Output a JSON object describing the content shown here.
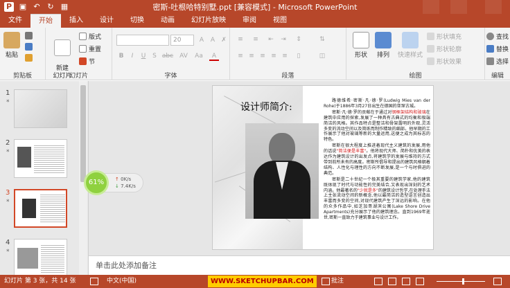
{
  "titlebar": {
    "title": "密斯-吐根哈特别墅.ppt [兼容模式] - Microsoft PowerPoint",
    "icons": [
      "app-icon",
      "save-icon",
      "undo-icon",
      "redo-icon",
      "start-icon"
    ]
  },
  "tabs": [
    "文件",
    "开始",
    "插入",
    "设计",
    "切换",
    "动画",
    "幻灯片放映",
    "审阅",
    "视图"
  ],
  "ribbon": {
    "clipboard": {
      "paste": "粘贴",
      "label": "剪贴板"
    },
    "slides": {
      "new_slide": "新建\n幻灯片",
      "layout": "版式",
      "reset": "重置",
      "section": "节",
      "label": "幻灯片"
    },
    "font": {
      "size": "20",
      "label": "字体",
      "buttons": [
        "B",
        "I",
        "U",
        "S",
        "abc",
        "AV",
        "Aa",
        "A"
      ]
    },
    "paragraph": {
      "label": "段落"
    },
    "drawing": {
      "shape": "形状",
      "arrange": "排列",
      "quick_styles": "快速样式",
      "fill": "形状填充",
      "outline": "形状轮廓",
      "effects": "形状效果",
      "label": "绘图"
    },
    "editing": {
      "find": "查找",
      "replace": "替换",
      "select": "选择",
      "label": "编辑"
    }
  },
  "thumbnails": [
    {
      "num": "1",
      "star": "*"
    },
    {
      "num": "2",
      "star": "*"
    },
    {
      "num": "3",
      "star": "*"
    },
    {
      "num": "4",
      "star": "*"
    }
  ],
  "slide": {
    "title": "设计师简介:",
    "para1_a": "路德维希·密斯·凡·德·罗(Ludwig Mies van der Rohe)于1886年3月27日出生在德国的亚琛古城。",
    "para2_a": "密斯·凡·德·罗的贡献在于通过对",
    "para2_red": "钢框架结构和玻璃",
    "para2_b": "在建筑中应用的探索,发展了一种具有古典式的均衡和极端简洁的风格。其作品特点是整洁和骨架露明的外观,灵活多变的流动空间以及简练而制作精致的细部。他早期的工作展示了他对玻璃等新的大量运用,这便之成为其标志的特色。",
    "para3_a": "密斯在很大程度上推进着现代主义建筑的发展,用他的话说",
    "para3_red": "\"简洁便是丰富\"",
    "para3_b": "。他将现代大师、简朴和优美的表达作为建筑设计的出发点,将建筑学的发展与维持的方式带到前所未有的高度。密斯所倡导和提出的建筑风格朝着结构、人性化与理性的方向不断发展,是一个与时俱进的典范。",
    "para4_a": "密斯是二十世纪一个极其重要的建筑学家,他的建筑既体现了时代与功能性的完美结合,又表现出深刻的艺术内涵。他最著名的",
    "para4_red": "\"少就是多\"",
    "para4_b": "的建筑设计哲学,在处理手法上主张流动空间的新概念,他以最简洁的造型语言创造出丰富而多变的空间,对现代建筑产生了深远的影响。在他的众多作品中,如芝加哥湖滨公寓",
    "para4_c": "(Lake Shore Drive Apartments)",
    "para4_d": "充分展示了他的建筑理念。直到1969年逝世,密斯一直致力于建筑事业与设计工作。"
  },
  "notes": {
    "placeholder": "单击此处添加备注"
  },
  "speed": {
    "percent": "61%",
    "up": "0K/s",
    "down": "7.4K/s"
  },
  "status": {
    "slide_info": "幻灯片 第 3 张，共 14 张",
    "language": "中文(中国)",
    "watermark": "WWW.SKETCHUPBAR.COM",
    "comments": "批注"
  }
}
